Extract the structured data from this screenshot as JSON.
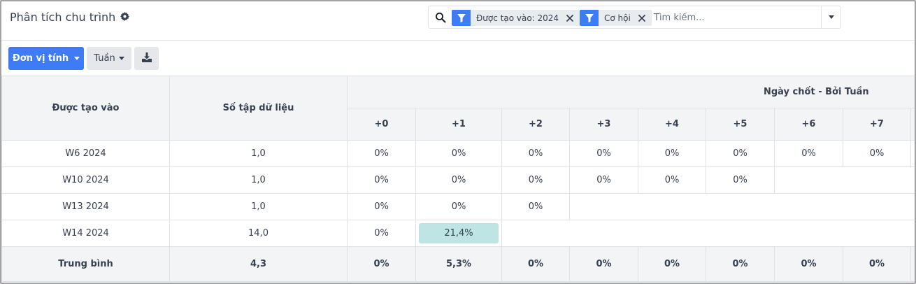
{
  "header": {
    "title": "Phân tích chu trình",
    "settings_icon": "gear-icon"
  },
  "search": {
    "facets": [
      {
        "label": "Được tạo vào: 2024",
        "icon": "filter-icon"
      },
      {
        "label": "Cơ hội",
        "icon": "filter-icon"
      }
    ],
    "placeholder": "Tìm kiếm..."
  },
  "toolbar": {
    "measure_label": "Đơn vị tính",
    "interval_label": "Tuần",
    "download_icon": "download-icon"
  },
  "colors": {
    "primary": "#3d7cf5",
    "highlight": "#bfe4e4"
  },
  "table": {
    "col_created": "Được tạo vào",
    "col_count": "Số tập dữ liệu",
    "group_header": "Ngày chốt - Bởi Tuần",
    "periods": [
      "+0",
      "+1",
      "+2",
      "+3",
      "+4",
      "+5",
      "+6",
      "+7"
    ],
    "rows": [
      {
        "label": "W6 2024",
        "count": "1,0",
        "values": [
          "0%",
          "0%",
          "0%",
          "0%",
          "0%",
          "0%",
          "0%",
          "0%"
        ]
      },
      {
        "label": "W10 2024",
        "count": "1,0",
        "values": [
          "0%",
          "0%",
          "0%",
          "0%",
          "0%",
          "0%",
          "",
          ""
        ]
      },
      {
        "label": "W13 2024",
        "count": "1,0",
        "values": [
          "0%",
          "0%",
          "0%",
          "",
          "",
          "",
          "",
          ""
        ]
      },
      {
        "label": "W14 2024",
        "count": "14,0",
        "values": [
          "0%",
          "21,4%",
          "",
          "",
          "",
          "",
          "",
          ""
        ]
      }
    ],
    "footer": {
      "label": "Trung bình",
      "count": "4,3",
      "values": [
        "0%",
        "5,3%",
        "0%",
        "0%",
        "0%",
        "0%",
        "0%",
        "0%"
      ]
    }
  }
}
